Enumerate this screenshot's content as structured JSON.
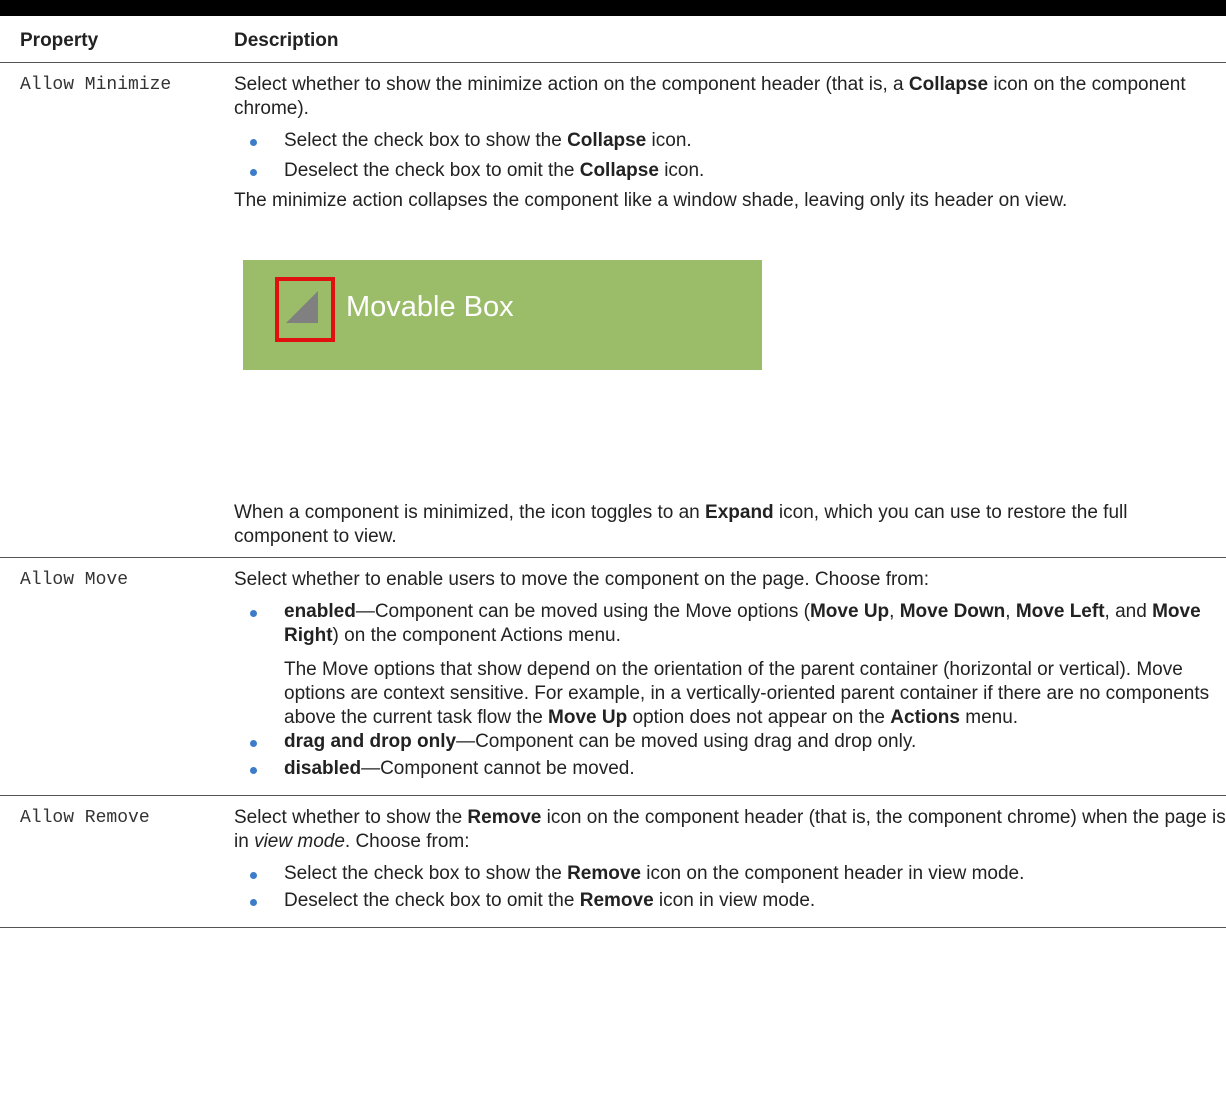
{
  "table": {
    "headers": {
      "property": "Property",
      "description": "Description"
    },
    "rows": [
      {
        "property": "Allow Minimize",
        "intro": [
          "Select whether to show the minimize action on the component header (that is, a ",
          "Collapse",
          " icon on the component chrome)."
        ],
        "bullets": [
          [
            "Select the check box to show the ",
            "Collapse",
            " icon."
          ],
          [
            "Deselect the check box to omit the ",
            "Collapse",
            " icon."
          ]
        ],
        "after": "The minimize action collapses the component like a window shade, leaving only its header on view.",
        "figure": {
          "label": "Movable Box",
          "bg_color": "#9bbd69",
          "highlight_color": "#e01010",
          "icon": "collapse-triangle-icon"
        },
        "closing": [
          "When a component is minimized, the icon toggles to an ",
          "Expand",
          " icon, which you can use to restore the full component to view."
        ]
      },
      {
        "property": "Allow Move",
        "intro": "Select whether to enable users to move the component on the page. Choose from:",
        "b1": {
          "term": "enabled",
          "t1": "—Component can be moved using the Move options (",
          "k1": "Move Up",
          "s1": ", ",
          "k2": "Move Down",
          "s2": ", ",
          "k3": "Move Left",
          "s3": ", and ",
          "k4": "Move Right",
          "s4": ") on the component Actions menu."
        },
        "sub": {
          "t1": "The Move options that show depend on the orientation of the parent container (horizontal or vertical). Move options are context sensitive. For example, in a vertically-oriented parent container if there are no components above the current task flow the ",
          "k1": "Move Up",
          "t2": " option does not appear on the ",
          "k2": "Actions",
          "t3": " menu."
        },
        "b2": {
          "term": "drag and drop only",
          "rest": "—Component can be moved using drag and drop only."
        },
        "b3": {
          "term": "disabled",
          "rest": "—Component cannot be moved."
        }
      },
      {
        "property": "Allow Remove",
        "intro": {
          "t1": "Select whether to show the ",
          "k1": "Remove",
          "t2": " icon on the component header (that is, the component chrome) when the page is in ",
          "em": "view mode",
          "t3": ". Choose from:"
        },
        "bullets": [
          [
            "Select the check box to show the ",
            "Remove",
            " icon on the component header in view mode."
          ],
          [
            "Deselect the check box to omit the ",
            "Remove",
            " icon in view mode."
          ]
        ]
      }
    ]
  },
  "colors": {
    "bullet": "#3d7cc9",
    "top_bar": "#000000"
  }
}
